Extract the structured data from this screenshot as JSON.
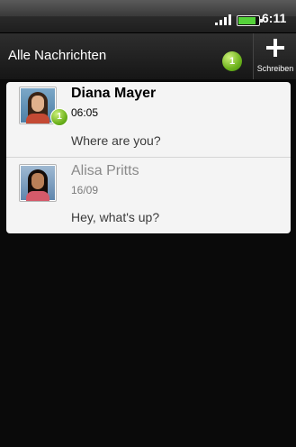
{
  "status_bar": {
    "time": "6:11",
    "battery_level": 0.8,
    "signal_bars": 4
  },
  "header": {
    "title": "Alle Nachrichten",
    "unread_count": "1",
    "compose_label": "Schreiben"
  },
  "messages": [
    {
      "sender": "Diana Mayer",
      "time": "06:05",
      "preview": "Where are you?",
      "unread_badge": "1",
      "unread": true
    },
    {
      "sender": "Alisa Pritts",
      "time": "16/09",
      "preview": "Hey, what's up?",
      "unread": false
    }
  ],
  "colors": {
    "accent_green": "#6fb31e",
    "list_bg": "#f4f4f4",
    "screen_bg": "#0a0a0a"
  }
}
